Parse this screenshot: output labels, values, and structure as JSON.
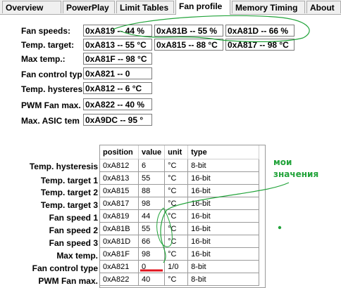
{
  "tabs": [
    "Overview",
    "PowerPlay",
    "Limit Tables",
    "Fan profile",
    "Memory Timing",
    "About"
  ],
  "active_tab": "Fan profile",
  "fan_profile": {
    "fan_speeds_label": "Fan speeds:",
    "fan_speeds": [
      "0xA819 -- 44 %",
      "0xA81B -- 55 %",
      "0xA81D -- 66 %"
    ],
    "temp_target_label": "Temp. target:",
    "temp_targets": [
      "0xA813 -- 55 °C",
      "0xA815 -- 88 °C",
      "0xA817 -- 98 °C"
    ],
    "max_temp_label": "Max temp.:",
    "max_temp": "0xA81F -- 98 °C",
    "fan_control_label": "Fan control typ",
    "fan_control": "0xA821 -- 0",
    "temp_hyst_label": "Temp. hysteres",
    "temp_hyst": "0xA812 -- 6 °C",
    "pwm_label": "PWM Fan max.",
    "pwm": "0xA822 -- 40 %",
    "asic_label": "Max. ASIC tem",
    "asic": "0xA9DC -- 95 °"
  },
  "lower_labels": [
    "Temp. hysteresis",
    "Temp. target 1",
    "Temp. target 2",
    "Temp. target 3",
    "Fan speed 1",
    "Fan speed 2",
    "Fan speed 3",
    "Max temp.",
    "Fan control type",
    "PWM Fan max."
  ],
  "table": {
    "headers": [
      "position",
      "value",
      "unit",
      "type"
    ],
    "rows": [
      [
        "0xA812",
        "6",
        "°C",
        "8-bit"
      ],
      [
        "0xA813",
        "55",
        "°C",
        "16-bit"
      ],
      [
        "0xA815",
        "88",
        "°C",
        "16-bit"
      ],
      [
        "0xA817",
        "98",
        "°C",
        "16-bit"
      ],
      [
        "0xA819",
        "44",
        "°C",
        "16-bit"
      ],
      [
        "0xA81B",
        "55",
        "°C",
        "16-bit"
      ],
      [
        "0xA81D",
        "66",
        "°C",
        "16-bit"
      ],
      [
        "0xA81F",
        "98",
        "°C",
        "16-bit"
      ],
      [
        "0xA821",
        "0",
        "1/0",
        "8-bit"
      ],
      [
        "0xA822",
        "40",
        "°C",
        "8-bit"
      ]
    ]
  },
  "annotation": {
    "line1": "мои",
    "line2": "значения",
    "color": "#22a33a"
  },
  "colors": {
    "underline": "#e0141e"
  }
}
